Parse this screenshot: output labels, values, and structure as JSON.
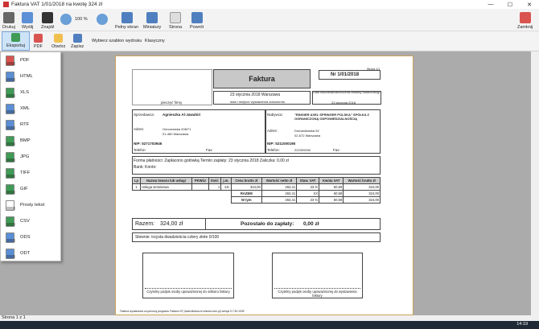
{
  "window": {
    "title": "Faktura VAT 1/01/2018 na kwotę 324 zł",
    "minimize": "—",
    "maximize": "☐",
    "close": "✕"
  },
  "toolbar": {
    "print": "Drukuj",
    "send": "Wyślij",
    "find": "Znajdź",
    "zoom": "100 %",
    "fullscreen": "Pełny ekran",
    "thumbs": "Miniatury",
    "page": "Strona",
    "back": "Powrót",
    "close": "Zamknij"
  },
  "toolbar2": {
    "export": "Eksportuj",
    "pdf": "PDF",
    "open": "Otwórz",
    "save": "Zapisz",
    "template_label": "Wybierz szablon wydruku",
    "template_value": "Klasyczny"
  },
  "export_menu": [
    {
      "label": "PDF",
      "color": "#d9534f"
    },
    {
      "label": "HTML",
      "color": "#5b8fd6"
    },
    {
      "label": "XLS",
      "color": "#3f9b55"
    },
    {
      "label": "XML",
      "color": "#5b8fd6"
    },
    {
      "label": "RTF",
      "color": "#5b8fd6"
    },
    {
      "label": "BMP",
      "color": "#3f9b55"
    },
    {
      "label": "JPG",
      "color": "#3f9b55"
    },
    {
      "label": "TIFF",
      "color": "#3f9b55"
    },
    {
      "label": "GIF",
      "color": "#3f9b55"
    },
    {
      "label": "Prosty tekst",
      "color": "#ffffff"
    },
    {
      "label": "CSV",
      "color": "#3f9b55"
    },
    {
      "label": "ODS",
      "color": "#5b8fd6"
    },
    {
      "label": "ODT",
      "color": "#5b8fd6"
    }
  ],
  "invoice": {
    "page_no": "Strona 1/1",
    "logo_label": "pieczęć firmy",
    "title": "Faktura",
    "number": "Nr   1/01/2018",
    "issue_date": "23 stycznia 2018 Warszawa",
    "issue_caption": "data i miejsce wystawienia dokumentu",
    "delivery_caption": "Data dokonania/zakończenia dostawy towaru/usługi:",
    "delivery_date": "23 stycznia 2018",
    "seller_label": "Sprzedawca:",
    "seller_name": "Agnieszka Al-Jawahiri",
    "seller_addr_label": "Adres:",
    "seller_addr1": "Górczewska 208/71",
    "seller_addr2": "01-460 Warszawa",
    "seller_nip": "NIP: 5271703946",
    "seller_tel": "Telefon:",
    "seller_fax": "Fax:",
    "buyer_label": "Nabywca:",
    "buyer_name": "\"RINGIER AXEL SPRINGER POLSKA\" SPÓŁKA Z OGRANICZONĄ ODPOWIEDZIALNOŚCIĄ",
    "buyer_addr_label": "Adres:",
    "buyer_addr1": "Domaniewska 52",
    "buyer_addr2": "02-672 Warszawa",
    "buyer_nip": "NIP: 5211000198",
    "buyer_tel": "Telefon:",
    "buyer_tel_val": "222320000",
    "buyer_fax": "Fax:",
    "payment": "Forma płatności: Zapłacono gotówką    Termin zapłaty: 23 stycznia 2018    Zaliczka: 0,00 zł",
    "bank": "Bank:     Konto:",
    "headers": [
      "Lp",
      "Nazwa towaru lub usługi",
      "PKWiU",
      "Ilość",
      "j.m.",
      "Cena brutto zł",
      "Wartość netto zł",
      "Staw. VAT",
      "Kwota VAT",
      "Wartość brutto zł"
    ],
    "rows": [
      [
        "1",
        "Usługa serwisowa",
        "",
        "1",
        "szt.",
        "324,00",
        "263,41",
        "23 %",
        "60,59",
        "324,00"
      ]
    ],
    "summary": [
      [
        "RAZEM",
        "263,41",
        "XX",
        "60,59",
        "324,00"
      ],
      [
        "W tym",
        "263,41",
        "23 %",
        "60,59",
        "324,00"
      ]
    ],
    "total_label": "Razem:",
    "total_value": "324,00 zł",
    "due_label": "Pozostało do zapłaty:",
    "due_value": "0,00 zł",
    "words": "Słownie:   trzysta dwadzieścia cztery złote 0/100",
    "sign_left": "Czytelny podpis osoby upoważnionej do odbioru faktury",
    "sign_right": "Czytelny podpis osoby upoważnionej do wystawienia faktury",
    "footer": "Faktura wystawiona za pomocą programu Faktura NT (www.faktura-nt.sekuria.com.pl) wersja 5.7.50.1038"
  },
  "status": "Strona 1 z 1",
  "clock": "14:19"
}
